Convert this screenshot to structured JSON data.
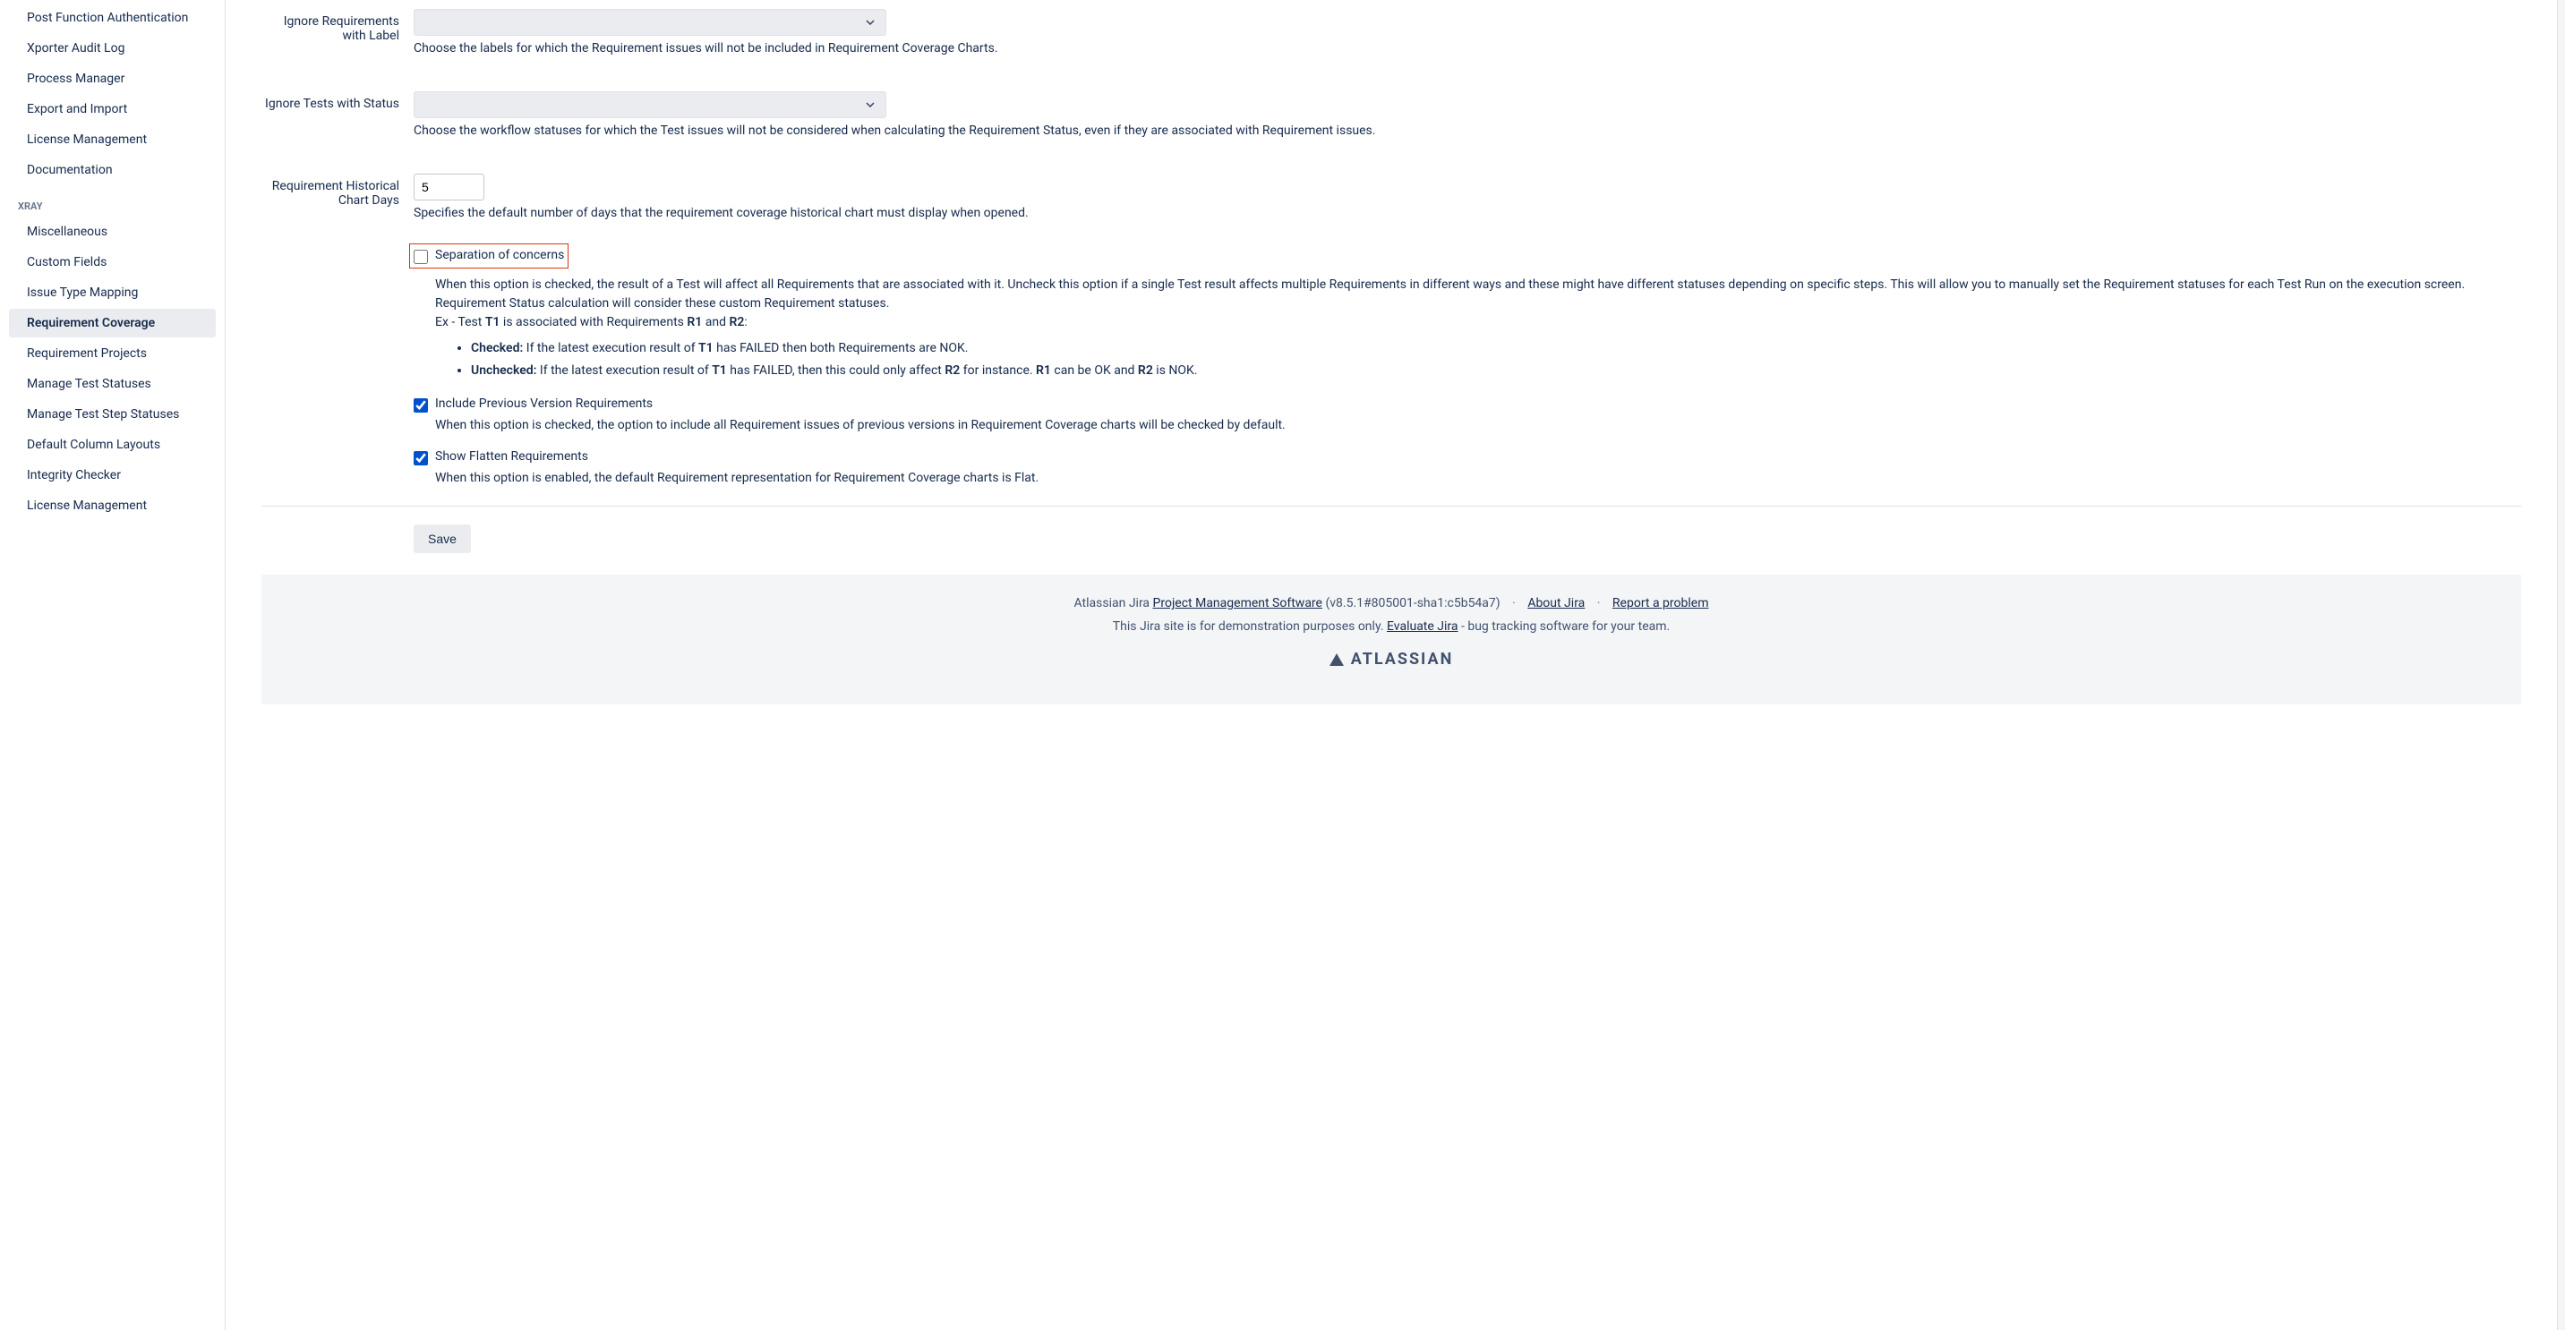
{
  "sidebar": {
    "topItems": [
      {
        "label": "Post Function Authentication"
      },
      {
        "label": "Xporter Audit Log"
      },
      {
        "label": "Process Manager"
      },
      {
        "label": "Export and Import"
      },
      {
        "label": "License Management"
      },
      {
        "label": "Documentation"
      }
    ],
    "sectionHeader": "XRAY",
    "xrayItems": [
      {
        "label": "Miscellaneous"
      },
      {
        "label": "Custom Fields"
      },
      {
        "label": "Issue Type Mapping"
      },
      {
        "label": "Requirement Coverage",
        "active": true
      },
      {
        "label": "Requirement Projects"
      },
      {
        "label": "Manage Test Statuses"
      },
      {
        "label": "Manage Test Step Statuses"
      },
      {
        "label": "Default Column Layouts"
      },
      {
        "label": "Integrity Checker"
      },
      {
        "label": "License Management"
      }
    ]
  },
  "form": {
    "ignoreReqLabel": "Ignore Requirements with Label",
    "ignoreReqHelp": "Choose the labels for which the Requirement issues will not be included in Requirement Coverage Charts.",
    "ignoreTestsLabel": "Ignore Tests with Status",
    "ignoreTestsHelp": "Choose the workflow statuses for which the Test issues will not be considered when calculating the Requirement Status, even if they are associated with Requirement issues.",
    "chartDaysLabel": "Requirement Historical Chart Days",
    "chartDaysValue": "5",
    "chartDaysHelp": "Specifies the default number of days that the requirement coverage historical chart must display when opened.",
    "separationLabel": "Separation of concerns",
    "separationDesc1": "When this option is checked, the result of a Test will affect all Requirements that are associated with it. Uncheck this option if a single Test result affects multiple Requirements in different ways and these might have different statuses depending on specific steps. This will allow you to manually set the Requirement statuses for each Test Run on the execution screen. Requirement Status calculation will consider these custom Requirement statuses.",
    "separationEx": "Ex - Test ",
    "separationExT1": "T1",
    "separationExMid": " is associated with Requirements ",
    "separationExR1": "R1",
    "separationExAnd": " and ",
    "separationExR2": "R2",
    "separationExEnd": ":",
    "checkedLabel": "Checked:",
    "checkedText1": " If the latest execution result of ",
    "checkedT1": "T1",
    "checkedText2": " has FAILED then both Requirements are NOK.",
    "uncheckedLabel": "Unchecked:",
    "uncheckedText1": " If the latest execution result of ",
    "uncheckedT1": "T1",
    "uncheckedText2": " has FAILED, then this could only affect ",
    "uncheckedR2": "R2",
    "uncheckedText3": " for instance. ",
    "uncheckedR1": "R1",
    "uncheckedText4": " can be OK and ",
    "uncheckedR2b": "R2",
    "uncheckedText5": " is NOK.",
    "includePrevLabel": "Include Previous Version Requirements",
    "includePrevDesc": "When this option is checked, the option to include all Requirement issues of previous versions in Requirement Coverage charts will be checked by default.",
    "showFlattenLabel": "Show Flatten Requirements",
    "showFlattenDesc": "When this option is enabled, the default Requirement representation for Requirement Coverage charts is Flat.",
    "saveLabel": "Save"
  },
  "footer": {
    "atlassianJira": "Atlassian Jira ",
    "pmSoftware": "Project Management Software",
    "version": " (v8.5.1#805001-sha1:c5b54a7)",
    "aboutJira": "About Jira",
    "reportProblem": "Report a problem",
    "demoText": "This Jira site is for demonstration purposes only. ",
    "evaluateJira": "Evaluate Jira",
    "bugTracking": " - bug tracking software for your team.",
    "atlassian": "ATLASSIAN"
  }
}
